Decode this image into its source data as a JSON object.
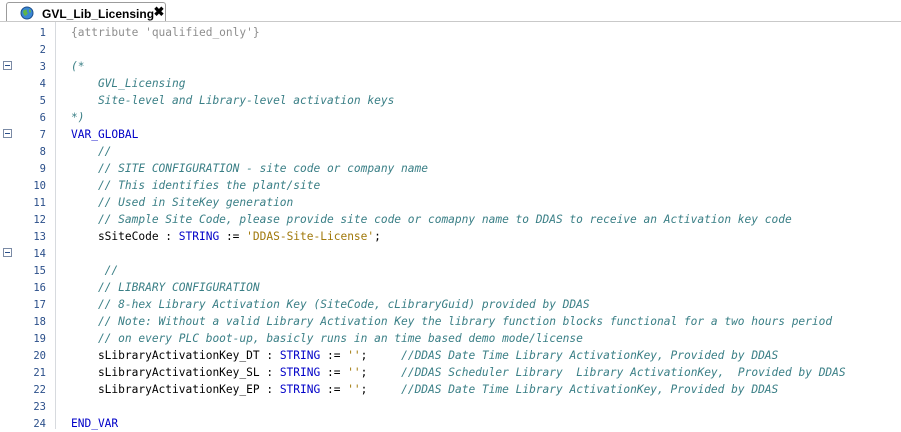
{
  "tab": {
    "label": "GVL_Lib_Licensing",
    "icon": "globe-icon",
    "close_glyph": "✖"
  },
  "lines": [
    {
      "n": "1",
      "fold": false,
      "parts": [
        {
          "t": "{attribute 'qualified_only'}",
          "c": "pragma"
        }
      ]
    },
    {
      "n": "2",
      "fold": false,
      "parts": []
    },
    {
      "n": "3",
      "fold": true,
      "parts": [
        {
          "t": "(*",
          "c": "comment"
        }
      ]
    },
    {
      "n": "4",
      "fold": false,
      "parts": [
        {
          "t": "    GVL_Licensing",
          "c": "comment"
        }
      ]
    },
    {
      "n": "5",
      "fold": false,
      "parts": [
        {
          "t": "    Site-level and Library-level activation keys",
          "c": "comment"
        }
      ]
    },
    {
      "n": "6",
      "fold": false,
      "parts": [
        {
          "t": "*)",
          "c": "comment"
        }
      ]
    },
    {
      "n": "7",
      "fold": true,
      "parts": [
        {
          "t": "VAR_GLOBAL",
          "c": "kw"
        }
      ]
    },
    {
      "n": "8",
      "fold": false,
      "parts": [
        {
          "t": "    //",
          "c": "comment"
        }
      ]
    },
    {
      "n": "9",
      "fold": false,
      "parts": [
        {
          "t": "    // SITE CONFIGURATION - site code or company name",
          "c": "comment"
        }
      ]
    },
    {
      "n": "10",
      "fold": false,
      "parts": [
        {
          "t": "    // This identifies the plant/site",
          "c": "comment"
        }
      ]
    },
    {
      "n": "11",
      "fold": false,
      "parts": [
        {
          "t": "    // Used in SiteKey generation",
          "c": "comment"
        }
      ]
    },
    {
      "n": "12",
      "fold": false,
      "parts": [
        {
          "t": "    // Sample Site Code, please provide site code or comapny name to DDAS to receive an Activation key code",
          "c": "comment"
        }
      ]
    },
    {
      "n": "13",
      "fold": false,
      "parts": [
        {
          "t": "    sSiteCode : ",
          "c": "plain"
        },
        {
          "t": "STRING",
          "c": "kw"
        },
        {
          "t": " := ",
          "c": "plain"
        },
        {
          "t": "'DDAS-Site-License'",
          "c": "str"
        },
        {
          "t": ";",
          "c": "plain"
        }
      ]
    },
    {
      "n": "14",
      "fold": true,
      "parts": []
    },
    {
      "n": "15",
      "fold": false,
      "parts": [
        {
          "t": "     //",
          "c": "comment"
        }
      ]
    },
    {
      "n": "16",
      "fold": false,
      "parts": [
        {
          "t": "    // LIBRARY CONFIGURATION",
          "c": "comment"
        }
      ]
    },
    {
      "n": "17",
      "fold": false,
      "parts": [
        {
          "t": "    // 8-hex Library Activation Key (SiteCode, cLibraryGuid) provided by DDAS",
          "c": "comment"
        }
      ]
    },
    {
      "n": "18",
      "fold": false,
      "parts": [
        {
          "t": "    // Note: Without a valid Library Activation Key the library function blocks functional for a two hours period",
          "c": "comment"
        }
      ]
    },
    {
      "n": "19",
      "fold": false,
      "parts": [
        {
          "t": "    // on every PLC boot-up, basicly runs in an time based demo mode/license",
          "c": "comment"
        }
      ]
    },
    {
      "n": "20",
      "fold": false,
      "parts": [
        {
          "t": "    sLibraryActivationKey_DT : ",
          "c": "plain"
        },
        {
          "t": "STRING",
          "c": "kw"
        },
        {
          "t": " := ",
          "c": "plain"
        },
        {
          "t": "''",
          "c": "str"
        },
        {
          "t": ";     ",
          "c": "plain"
        },
        {
          "t": "//DDAS Date Time Library ActivationKey, Provided by DDAS",
          "c": "comment"
        }
      ]
    },
    {
      "n": "21",
      "fold": false,
      "parts": [
        {
          "t": "    sLibraryActivationKey_SL : ",
          "c": "plain"
        },
        {
          "t": "STRING",
          "c": "kw"
        },
        {
          "t": " := ",
          "c": "plain"
        },
        {
          "t": "''",
          "c": "str"
        },
        {
          "t": ";     ",
          "c": "plain"
        },
        {
          "t": "//DDAS Scheduler Library  Library ActivationKey,  Provided by DDAS",
          "c": "comment"
        }
      ]
    },
    {
      "n": "22",
      "fold": false,
      "parts": [
        {
          "t": "    sLibraryActivationKey_EP : ",
          "c": "plain"
        },
        {
          "t": "STRING",
          "c": "kw"
        },
        {
          "t": " := ",
          "c": "plain"
        },
        {
          "t": "''",
          "c": "str"
        },
        {
          "t": ";     ",
          "c": "plain"
        },
        {
          "t": "//DDAS Date Time Library ActivationKey, Provided by DDAS",
          "c": "comment"
        }
      ]
    },
    {
      "n": "23",
      "fold": false,
      "parts": []
    },
    {
      "n": "24",
      "fold": false,
      "parts": [
        {
          "t": "END_VAR",
          "c": "kw"
        }
      ]
    }
  ],
  "colors": {
    "comment": "#3a7f86",
    "keyword": "#0000c8",
    "string": "#a0780a",
    "pragma": "#8e8e8e",
    "line_number": "#2b4f8a"
  }
}
